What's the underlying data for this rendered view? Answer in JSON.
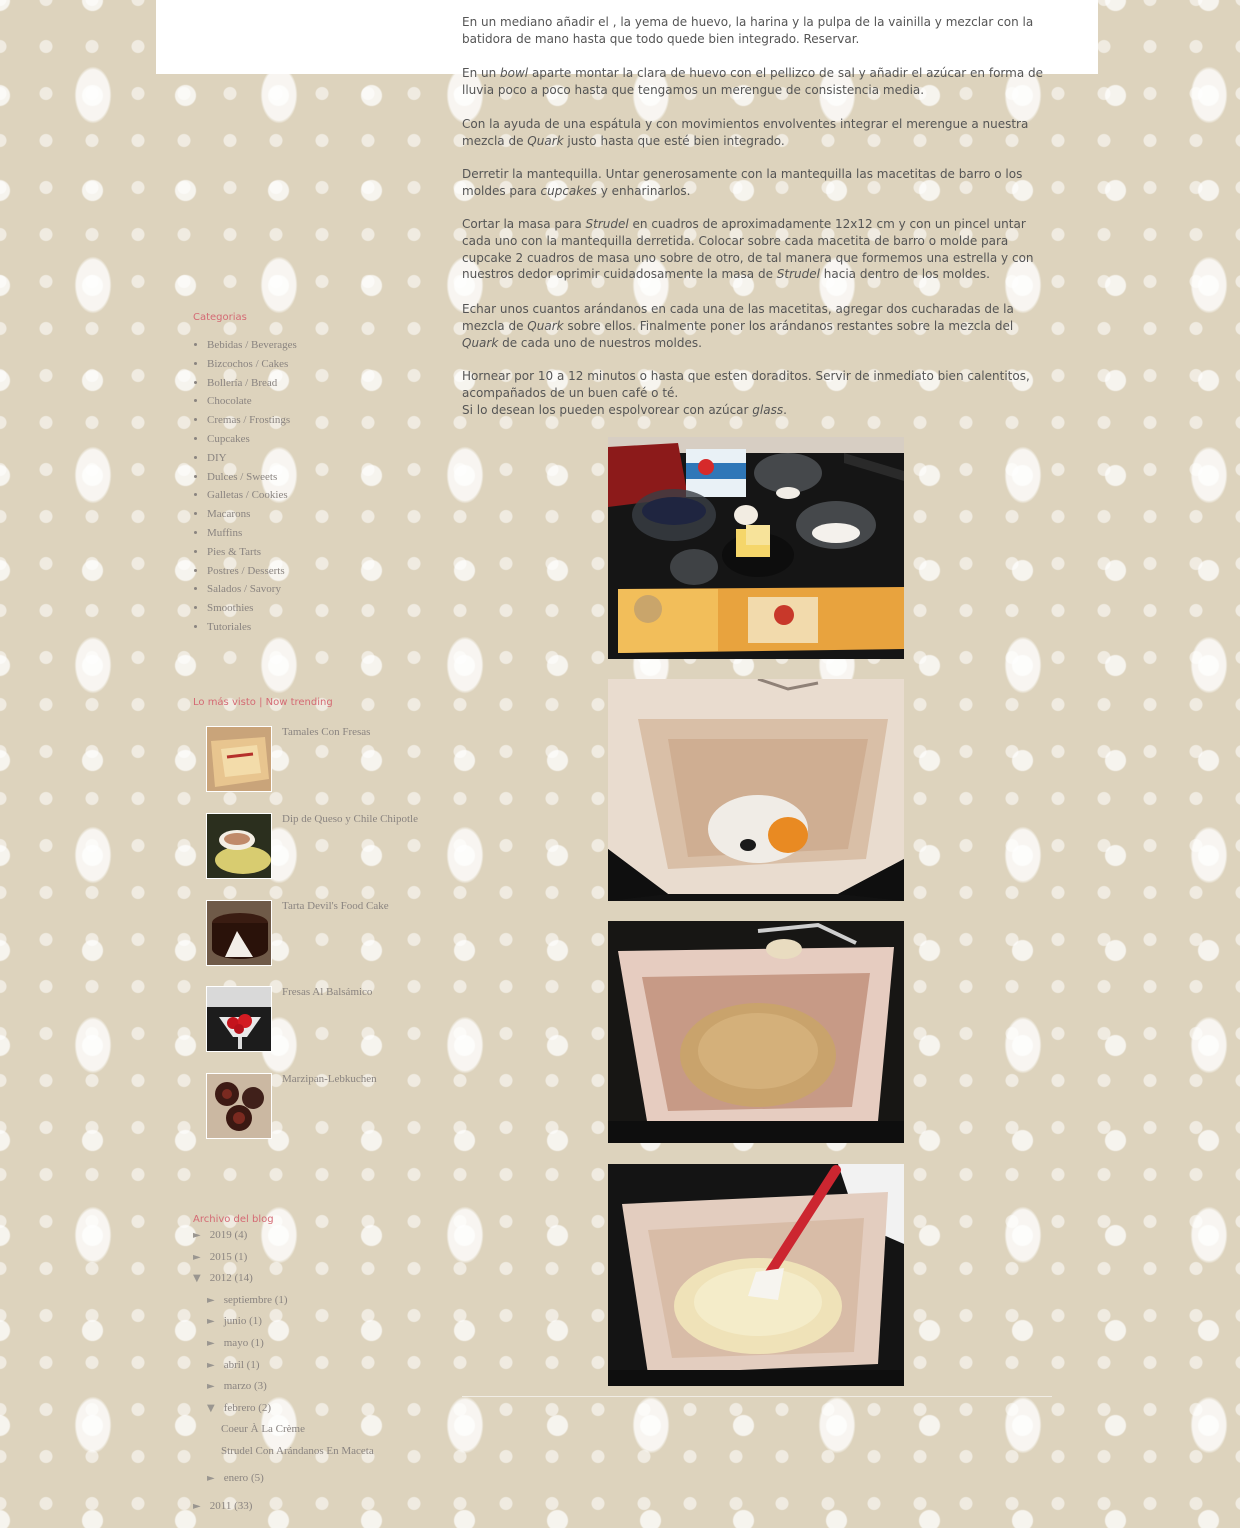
{
  "post": {
    "p1": "En un mediano añadir el , la yema de huevo, la harina y la pulpa de la vainilla y mezclar con la batidora de mano hasta que todo quede bien integrado. Reservar.",
    "p2_pre": "En un ",
    "p2_em": "bowl",
    "p2_post": " aparte montar la clara de huevo con el pellizco de sal y añadir el azúcar en forma de lluvia poco a poco hasta que tengamos un merengue de consistencia media.",
    "p3_pre": "Con la ayuda de una espátula y con movimientos envolventes integrar el merengue a nuestra mezcla de ",
    "p3_em": "Quark",
    "p3_post": " justo hasta que esté bien integrado.",
    "p4_pre": "Derretir la mantequilla. Untar generosamente con la mantequilla las macetitas de barro o los moldes para ",
    "p4_em": "cupcakes",
    "p4_post": " y enharinarlos.",
    "p5_a": "Cortar la masa para ",
    "p5_em1": "Strudel",
    "p5_b": " en cuadros de aproximadamente 12x12 cm y con un pincel untar cada uno con la mantequilla derretida. Colocar sobre cada macetita de barro o molde para cupcake 2 cuadros de masa uno sobre de otro, de tal manera que formemos una estrella y con nuestros dedor oprimir cuidadosamente la masa de ",
    "p5_em2": "Strudel",
    "p5_c": " hacia dentro de los moldes.",
    "p6_a": "Echar unos cuantos arándanos en cada una de las macetitas, agregar dos cucharadas de la mezcla de ",
    "p6_em1": "Quark",
    "p6_b": " sobre ellos. Finalmente poner los arándanos restantes sobre la mezcla del ",
    "p6_em2": "Quark",
    "p6_c": " de cada uno de nuestros moldes.",
    "p7_line1": "Hornear por 10 a 12 minutos o hasta que esten doraditos. Servir de inmediato bien calentitos, acompañados de un buen café o té.",
    "p7_line2_pre": "Si lo desean los pueden espolvorear con azúcar ",
    "p7_line2_em": "glass",
    "p7_line2_post": "."
  },
  "sidebar": {
    "categories_title": "Categorias",
    "categories": [
      "Bebidas / Beverages",
      "Bizcochos / Cakes",
      "Bollería / Bread",
      "Chocolate",
      "Cremas / Frostings",
      "Cupcakes",
      "DIY",
      "Dulces / Sweets",
      "Galletas / Cookies",
      "Macarons",
      "Muffins",
      "Pies & Tarts",
      "Postres / Desserts",
      "Salados / Savory",
      "Smoothies",
      "Tutoriales"
    ],
    "popular_title": "Lo más visto | Now trending",
    "popular": [
      "Tamales Con Fresas",
      "Dip de Queso y Chile Chipotle",
      "Tarta Devil's Food Cake",
      "Fresas Al Balsámico",
      "Marzipan-Lebkuchen"
    ],
    "archive_title": "Archivo del blog",
    "archive": {
      "y2019": "2019",
      "y2019_count": "(4)",
      "y2015": "2015",
      "y2015_count": "(1)",
      "y2012": "2012",
      "y2012_count": "(14)",
      "sep": "septiembre",
      "sep_count": "(1)",
      "jun": "junio",
      "jun_count": "(1)",
      "may": "mayo",
      "may_count": "(1)",
      "apr": "abril",
      "apr_count": "(1)",
      "mar": "marzo",
      "mar_count": "(3)",
      "feb": "febrero",
      "feb_count": "(2)",
      "post1": "Coeur À La Crème",
      "post2": "Strudel Con Arándanos En Maceta",
      "jan": "enero",
      "jan_count": "(5)",
      "y2011": "2011",
      "y2011_count": "(33)",
      "collapsed_glyph": "►",
      "expanded_glyph": "▼"
    }
  },
  "icons": {
    "collapsed": "triangle-right-icon",
    "expanded": "triangle-down-icon"
  },
  "colors": {
    "background": "#ddd3bd",
    "widget_title": "#d46a74",
    "body_text": "#555555",
    "link_text": "#8a8480"
  }
}
